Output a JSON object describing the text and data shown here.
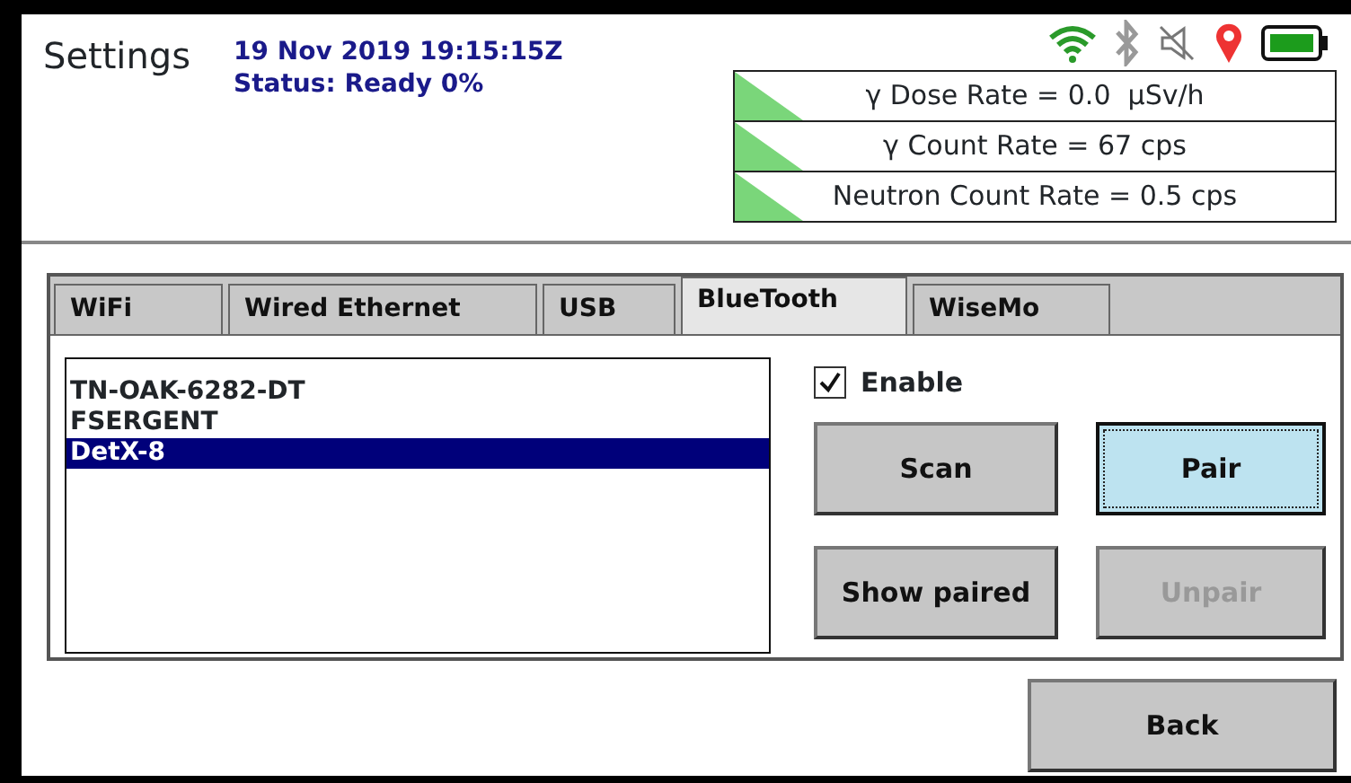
{
  "header": {
    "title": "Settings",
    "datetime": "19 Nov 2019 19:15:15Z",
    "status": "Status: Ready 0%"
  },
  "readings": [
    {
      "text": "γ Dose Rate = 0.0  μSv/h"
    },
    {
      "text": "γ Count Rate = 67 cps"
    },
    {
      "text": "Neutron Count Rate = 0.5 cps"
    }
  ],
  "tabs": [
    {
      "label": "WiFi",
      "selected": false
    },
    {
      "label": "Wired Ethernet",
      "selected": false
    },
    {
      "label": "USB",
      "selected": false
    },
    {
      "label": "BlueTooth",
      "selected": true
    },
    {
      "label": "WiseMo",
      "selected": false
    }
  ],
  "devices": [
    {
      "name": "TN-OAK-6282-DT",
      "selected": false
    },
    {
      "name": "FSERGENT",
      "selected": false
    },
    {
      "name": "DetX-8",
      "selected": true
    }
  ],
  "enable": {
    "label": "Enable",
    "checked": true
  },
  "buttons": [
    {
      "label": "Scan",
      "focused": false,
      "disabled": false
    },
    {
      "label": "Pair",
      "focused": true,
      "disabled": false
    },
    {
      "label": "Show paired",
      "focused": false,
      "disabled": false
    },
    {
      "label": "Unpair",
      "focused": false,
      "disabled": true
    }
  ],
  "back": {
    "label": "Back"
  }
}
